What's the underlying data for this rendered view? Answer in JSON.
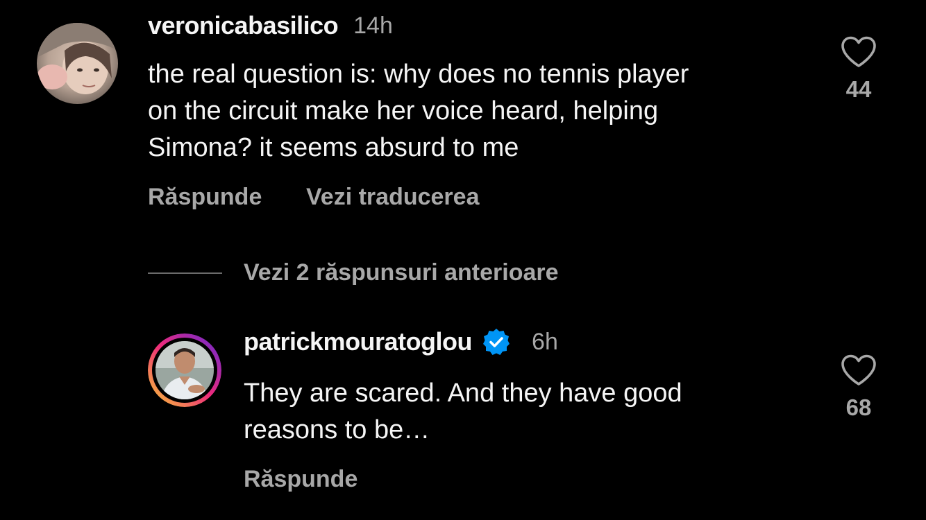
{
  "comments": [
    {
      "username": "veronicabasilico",
      "time": "14h",
      "text": "the real question is: why does no tennis player\non the circuit make her voice heard, helping\nSimona? it seems absurd to me",
      "reply_label": "Răspunde",
      "translate_label": "Vezi traducerea",
      "like_count": "44"
    },
    {
      "username": "patrickmouratoglou",
      "verified": true,
      "time": "6h",
      "text": "They are scared. And they have good\nreasons to be…",
      "reply_label": "Răspunde",
      "like_count": "68"
    }
  ],
  "view_previous_replies": "Vezi 2 răspunsuri anterioare",
  "colors": {
    "background": "#000000",
    "primary_text": "#f5f5f5",
    "secondary_text": "#a8a8a8",
    "verified_badge": "#0095f6",
    "story_ring_start": "#f9ce34",
    "story_ring_mid": "#ee2a7b",
    "story_ring_end": "#6228d7"
  },
  "icons": {
    "like": "heart-outline-icon",
    "verified": "verified-badge-icon"
  }
}
